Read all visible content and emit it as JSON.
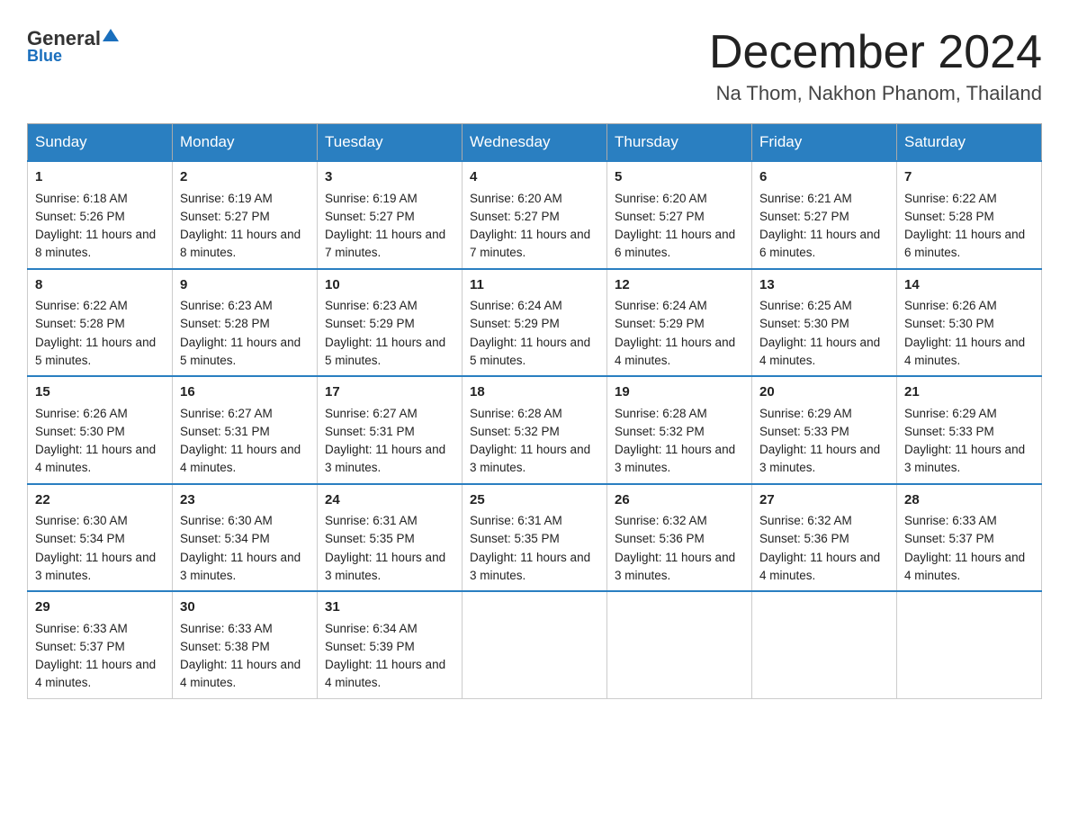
{
  "logo": {
    "general": "General",
    "blue": "Blue"
  },
  "title": "December 2024",
  "subtitle": "Na Thom, Nakhon Phanom, Thailand",
  "days": [
    "Sunday",
    "Monday",
    "Tuesday",
    "Wednesday",
    "Thursday",
    "Friday",
    "Saturday"
  ],
  "weeks": [
    [
      {
        "num": "1",
        "sunrise": "6:18 AM",
        "sunset": "5:26 PM",
        "daylight": "11 hours and 8 minutes."
      },
      {
        "num": "2",
        "sunrise": "6:19 AM",
        "sunset": "5:27 PM",
        "daylight": "11 hours and 8 minutes."
      },
      {
        "num": "3",
        "sunrise": "6:19 AM",
        "sunset": "5:27 PM",
        "daylight": "11 hours and 7 minutes."
      },
      {
        "num": "4",
        "sunrise": "6:20 AM",
        "sunset": "5:27 PM",
        "daylight": "11 hours and 7 minutes."
      },
      {
        "num": "5",
        "sunrise": "6:20 AM",
        "sunset": "5:27 PM",
        "daylight": "11 hours and 6 minutes."
      },
      {
        "num": "6",
        "sunrise": "6:21 AM",
        "sunset": "5:27 PM",
        "daylight": "11 hours and 6 minutes."
      },
      {
        "num": "7",
        "sunrise": "6:22 AM",
        "sunset": "5:28 PM",
        "daylight": "11 hours and 6 minutes."
      }
    ],
    [
      {
        "num": "8",
        "sunrise": "6:22 AM",
        "sunset": "5:28 PM",
        "daylight": "11 hours and 5 minutes."
      },
      {
        "num": "9",
        "sunrise": "6:23 AM",
        "sunset": "5:28 PM",
        "daylight": "11 hours and 5 minutes."
      },
      {
        "num": "10",
        "sunrise": "6:23 AM",
        "sunset": "5:29 PM",
        "daylight": "11 hours and 5 minutes."
      },
      {
        "num": "11",
        "sunrise": "6:24 AM",
        "sunset": "5:29 PM",
        "daylight": "11 hours and 5 minutes."
      },
      {
        "num": "12",
        "sunrise": "6:24 AM",
        "sunset": "5:29 PM",
        "daylight": "11 hours and 4 minutes."
      },
      {
        "num": "13",
        "sunrise": "6:25 AM",
        "sunset": "5:30 PM",
        "daylight": "11 hours and 4 minutes."
      },
      {
        "num": "14",
        "sunrise": "6:26 AM",
        "sunset": "5:30 PM",
        "daylight": "11 hours and 4 minutes."
      }
    ],
    [
      {
        "num": "15",
        "sunrise": "6:26 AM",
        "sunset": "5:30 PM",
        "daylight": "11 hours and 4 minutes."
      },
      {
        "num": "16",
        "sunrise": "6:27 AM",
        "sunset": "5:31 PM",
        "daylight": "11 hours and 4 minutes."
      },
      {
        "num": "17",
        "sunrise": "6:27 AM",
        "sunset": "5:31 PM",
        "daylight": "11 hours and 3 minutes."
      },
      {
        "num": "18",
        "sunrise": "6:28 AM",
        "sunset": "5:32 PM",
        "daylight": "11 hours and 3 minutes."
      },
      {
        "num": "19",
        "sunrise": "6:28 AM",
        "sunset": "5:32 PM",
        "daylight": "11 hours and 3 minutes."
      },
      {
        "num": "20",
        "sunrise": "6:29 AM",
        "sunset": "5:33 PM",
        "daylight": "11 hours and 3 minutes."
      },
      {
        "num": "21",
        "sunrise": "6:29 AM",
        "sunset": "5:33 PM",
        "daylight": "11 hours and 3 minutes."
      }
    ],
    [
      {
        "num": "22",
        "sunrise": "6:30 AM",
        "sunset": "5:34 PM",
        "daylight": "11 hours and 3 minutes."
      },
      {
        "num": "23",
        "sunrise": "6:30 AM",
        "sunset": "5:34 PM",
        "daylight": "11 hours and 3 minutes."
      },
      {
        "num": "24",
        "sunrise": "6:31 AM",
        "sunset": "5:35 PM",
        "daylight": "11 hours and 3 minutes."
      },
      {
        "num": "25",
        "sunrise": "6:31 AM",
        "sunset": "5:35 PM",
        "daylight": "11 hours and 3 minutes."
      },
      {
        "num": "26",
        "sunrise": "6:32 AM",
        "sunset": "5:36 PM",
        "daylight": "11 hours and 3 minutes."
      },
      {
        "num": "27",
        "sunrise": "6:32 AM",
        "sunset": "5:36 PM",
        "daylight": "11 hours and 4 minutes."
      },
      {
        "num": "28",
        "sunrise": "6:33 AM",
        "sunset": "5:37 PM",
        "daylight": "11 hours and 4 minutes."
      }
    ],
    [
      {
        "num": "29",
        "sunrise": "6:33 AM",
        "sunset": "5:37 PM",
        "daylight": "11 hours and 4 minutes."
      },
      {
        "num": "30",
        "sunrise": "6:33 AM",
        "sunset": "5:38 PM",
        "daylight": "11 hours and 4 minutes."
      },
      {
        "num": "31",
        "sunrise": "6:34 AM",
        "sunset": "5:39 PM",
        "daylight": "11 hours and 4 minutes."
      },
      null,
      null,
      null,
      null
    ]
  ],
  "labels": {
    "sunrise": "Sunrise:",
    "sunset": "Sunset:",
    "daylight": "Daylight:"
  }
}
